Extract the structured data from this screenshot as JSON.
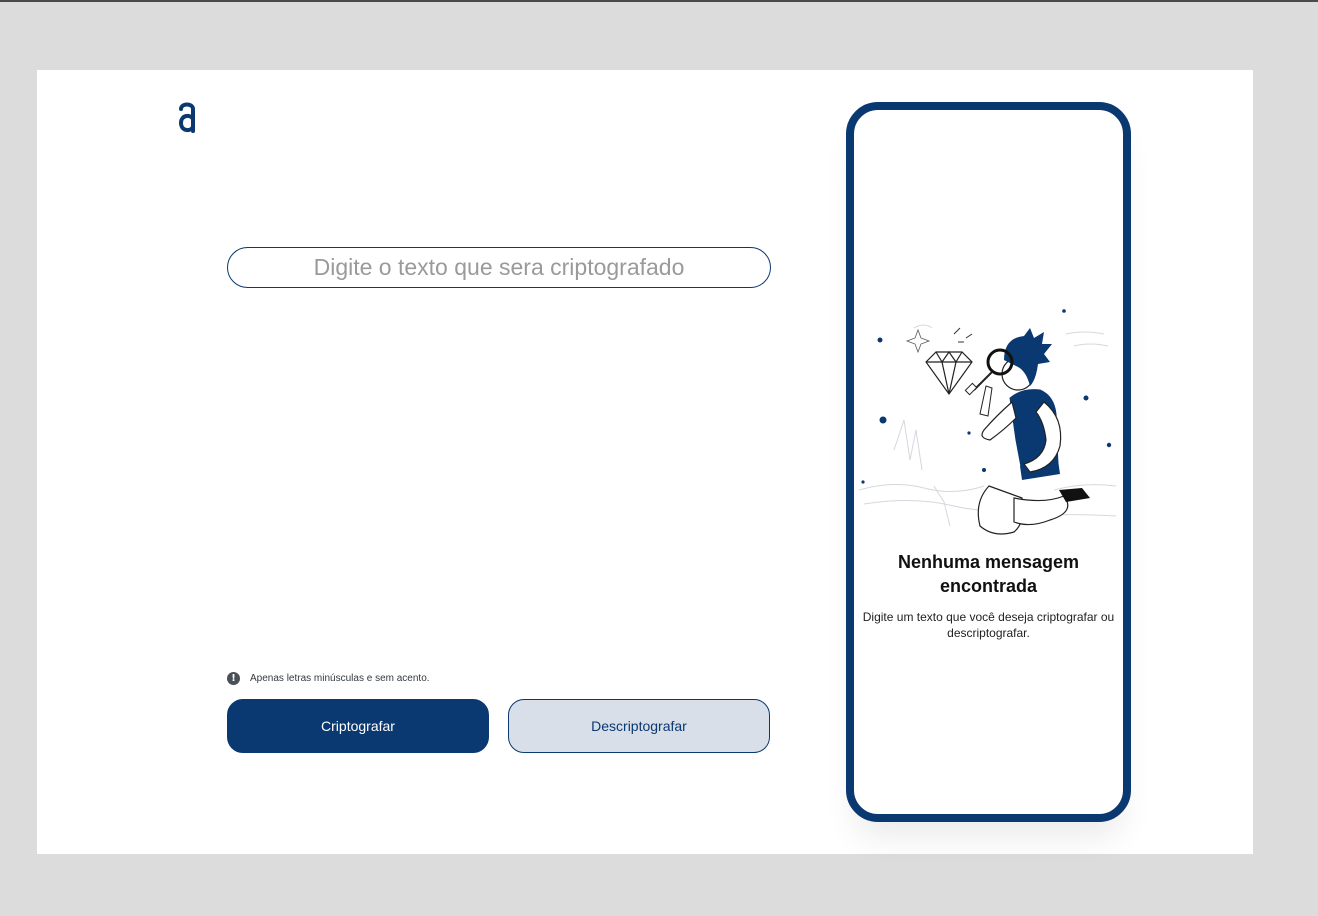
{
  "app": {
    "logo_icon": "alura-a-logo-icon",
    "brand_color": "#0a3871"
  },
  "input": {
    "placeholder": "Digite o texto que sera criptografado",
    "value": ""
  },
  "hint": {
    "icon": "exclamation-circle-icon",
    "text": "Apenas letras minúsculas e sem acento."
  },
  "buttons": {
    "encrypt_label": "Criptografar",
    "decrypt_label": "Descriptografar"
  },
  "output_panel": {
    "illustration": "person-with-magnifying-glass-illustration",
    "title_line1": "Nenhuma mensagem",
    "title_line2": "encontrada",
    "description": "Digite um texto que você deseja criptografar ou descriptografar."
  }
}
